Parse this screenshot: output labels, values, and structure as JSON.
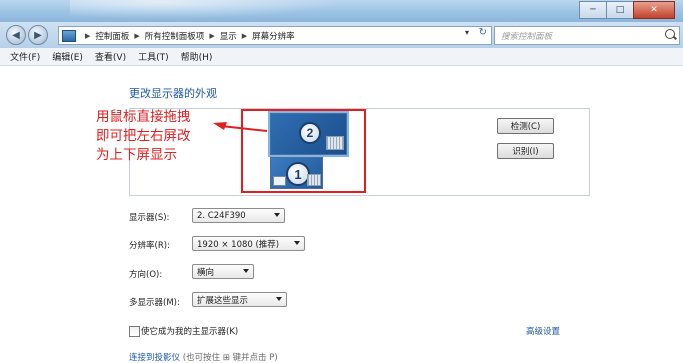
{
  "window": {
    "controls": {
      "minimize": "─",
      "maximize": "□",
      "close": "✕"
    }
  },
  "address": {
    "crumbs": [
      "控制面板",
      "所有控制面板项",
      "显示",
      "屏幕分辨率"
    ],
    "search_placeholder": "搜索控制面板",
    "dropdown_glyph": "▾",
    "refresh_glyph": "↻"
  },
  "nav": {
    "back": "◀",
    "forward": "▶"
  },
  "menu": [
    "文件(F)",
    "编辑(E)",
    "查看(V)",
    "工具(T)",
    "帮助(H)"
  ],
  "page": {
    "heading": "更改显示器的外观",
    "annotation": "用鼠标直接拖拽\n即可把左右屏改\n为上下屏显示",
    "monitors": [
      "2",
      "1"
    ],
    "buttons": {
      "detect": "检测(C)",
      "identify": "识别(I)"
    },
    "fields": {
      "display": {
        "label": "显示器(S):",
        "value": "2. C24F390"
      },
      "resolution": {
        "label": "分辨率(R):",
        "value": "1920 × 1080 (推荐)"
      },
      "orientation": {
        "label": "方向(O):",
        "value": "横向"
      },
      "multi": {
        "label": "多显示器(M):",
        "value": "扩展这些显示"
      }
    },
    "checkbox_label": "使它成为我的主显示器(K)",
    "advanced_link": "高级设置",
    "bottom_link": "连接到投影仪",
    "bottom_rest": "(也可按住 ⊞ 键并点击 P)"
  },
  "colors": {
    "annotation": "#e02020",
    "link": "#1e5aa8",
    "monitor_fill": "#2f6eb4"
  }
}
